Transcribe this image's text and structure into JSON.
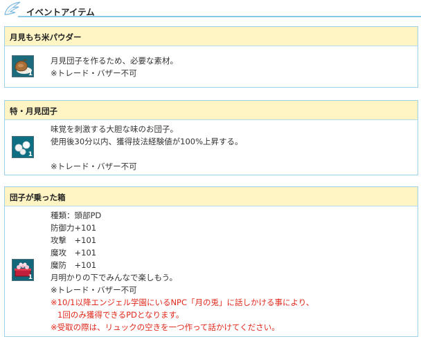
{
  "section": {
    "title": "イベントアイテム"
  },
  "items": [
    {
      "name": "月見もち米パウダー",
      "count": "1",
      "lines": [
        "月見団子を作るため、必要な素材。",
        "※トレード・バザー不可"
      ]
    },
    {
      "name": "特・月見団子",
      "count": "1",
      "lines": [
        "味覚を刺激する大胆な味のお団子。",
        "使用後30分以内、獲得技法経験値が100%上昇する。",
        "",
        "※トレード・バザー不可"
      ]
    },
    {
      "name": "団子が乗った箱",
      "count": "1",
      "lines": [
        "種類：頭部PD",
        "防御力+101",
        "攻撃　+101",
        "魔攻　+101",
        "魔防　+101",
        "月明かりの下でみんなで楽しもう。",
        "※トレード・バザー不可"
      ],
      "red_lines": [
        "※10/1以降エンジェル学園にいるNPC「月の兎」に話しかける事により、",
        "1回のみ獲得できるPDとなります。",
        "※受取の際は、リュックの空きを一つ作って話かけてください。"
      ]
    }
  ],
  "colors": {
    "accent": "#8cc8e8",
    "header_bg": "#fff4c4",
    "alert": "#e0271a"
  }
}
